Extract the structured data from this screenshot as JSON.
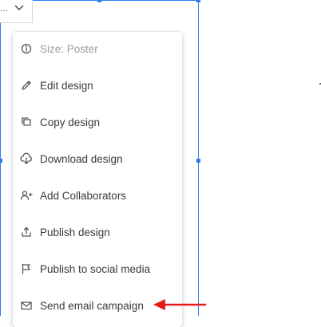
{
  "colors": {
    "selection": "#2e7bf6",
    "arrow": "#e21b1b"
  },
  "chip": {
    "text": "..."
  },
  "menu": {
    "items": [
      {
        "label": "Size: Poster",
        "icon": "info-icon"
      },
      {
        "label": "Edit design",
        "icon": "pencil-icon"
      },
      {
        "label": "Copy design",
        "icon": "copy-icon"
      },
      {
        "label": "Download design",
        "icon": "cloud-download-icon"
      },
      {
        "label": "Add Collaborators",
        "icon": "add-user-icon"
      },
      {
        "label": "Publish design",
        "icon": "upload-icon"
      },
      {
        "label": "Publish to social media",
        "icon": "flag-icon"
      },
      {
        "label": "Send email campaign",
        "icon": "mail-icon"
      }
    ]
  }
}
